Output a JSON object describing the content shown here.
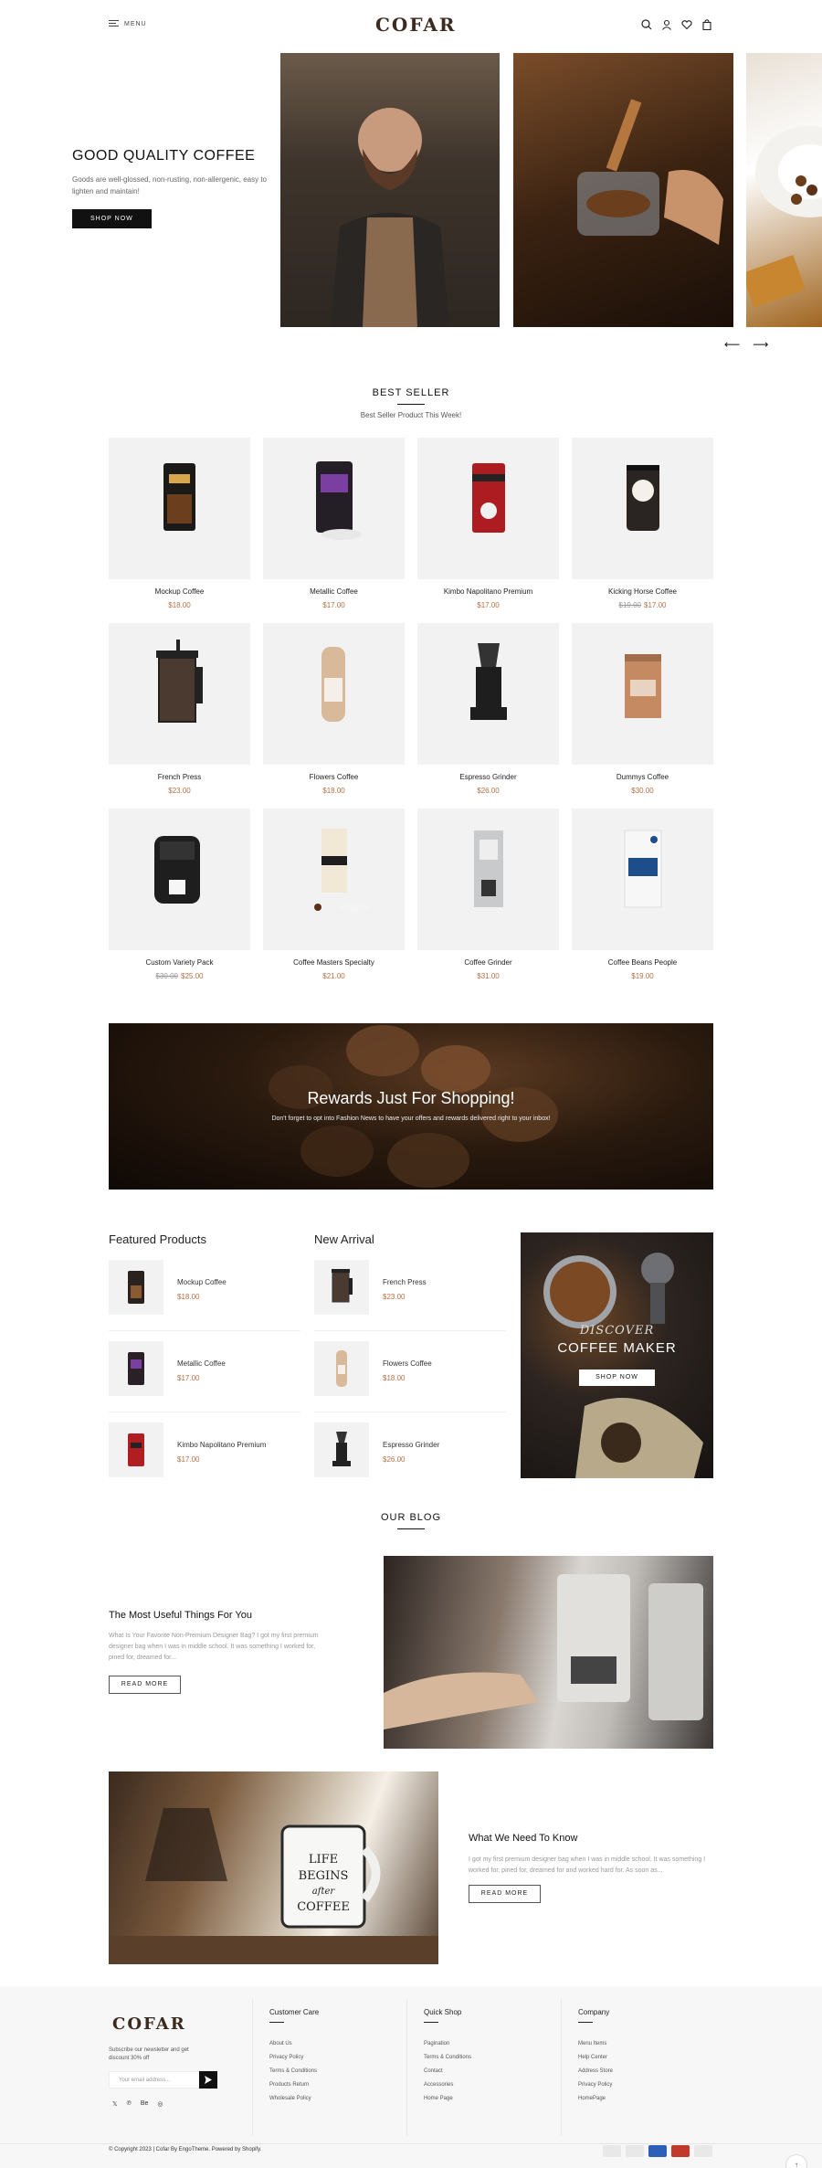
{
  "header": {
    "menu_label": "MENU",
    "logo": "COFAR"
  },
  "hero": {
    "title": "GOOD QUALITY COFFEE",
    "description": "Goods are well-glossed, non-rusting, non-allergenic, easy to lighten and maintain!",
    "button": "SHOP NOW"
  },
  "best_seller": {
    "title": "BEST SELLER",
    "subtitle": "Best Seller Product This Week!",
    "products": [
      {
        "name": "Mockup Coffee",
        "old_price": "",
        "price": "$18.00"
      },
      {
        "name": "Metallic Coffee",
        "old_price": "",
        "price": "$17.00"
      },
      {
        "name": "Kimbo Napolitano Premium",
        "old_price": "",
        "price": "$17.00"
      },
      {
        "name": "Kicking Horse Coffee",
        "old_price": "$19.00",
        "price": "$17.00"
      },
      {
        "name": "French Press",
        "old_price": "",
        "price": "$23.00"
      },
      {
        "name": "Flowers Coffee",
        "old_price": "",
        "price": "$18.00"
      },
      {
        "name": "Espresso Grinder",
        "old_price": "",
        "price": "$26.00"
      },
      {
        "name": "Dummys Coffee",
        "old_price": "",
        "price": "$30.00"
      },
      {
        "name": "Custom Variety Pack",
        "old_price": "$30.00",
        "price": "$25.00"
      },
      {
        "name": "Coffee Masters Specialty",
        "old_price": "",
        "price": "$21.00"
      },
      {
        "name": "Coffee Grinder",
        "old_price": "",
        "price": "$31.00"
      },
      {
        "name": "Coffee Beans People",
        "old_price": "",
        "price": "$19.00"
      }
    ]
  },
  "rewards": {
    "title": "Rewards Just For Shopping!",
    "subtitle": "Don't forget to opt into Fashion News to have your offers and rewards delivered right to your inbox!"
  },
  "featured": {
    "title": "Featured Products",
    "items": [
      {
        "name": "Mockup Coffee",
        "price": "$18.00"
      },
      {
        "name": "Metallic Coffee",
        "price": "$17.00"
      },
      {
        "name": "Kimbo Napolitano Premium",
        "price": "$17.00"
      }
    ]
  },
  "new_arrival": {
    "title": "New Arrival",
    "items": [
      {
        "name": "French Press",
        "price": "$23.00"
      },
      {
        "name": "Flowers Coffee",
        "price": "$18.00"
      },
      {
        "name": "Espresso Grinder",
        "price": "$26.00"
      }
    ]
  },
  "discover": {
    "subtitle": "DISCOVER",
    "title": "COFFEE MAKER",
    "button": "SHOP NOW"
  },
  "blog": {
    "title": "OUR BLOG",
    "posts": [
      {
        "title": "The Most Useful Things For You",
        "excerpt": "What Is Your Favorite Non-Premium Designer Bag? I got my first premium designer bag when I was in middle school. It was something I worked for, pined for, dreamed for...",
        "button": "READ MORE"
      },
      {
        "title": "What We Need To Know",
        "excerpt": "I got my first premium designer bag when I was in middle school. It was something I worked for, pined for, dreamed for and worked hard for. As soon as...",
        "button": "READ MORE"
      }
    ]
  },
  "footer": {
    "logo": "COFAR",
    "newsletter_text": "Subscribe our newsletter and get discount 30% off",
    "email_placeholder": "Your email address...",
    "social": [
      "𝕏",
      "℗",
      "Be",
      "◎"
    ],
    "columns": [
      {
        "title": "Customer Care",
        "links": [
          "About Us",
          "Privacy Policy",
          "Terms & Conditions",
          "Products Return",
          "Wholesale Policy"
        ]
      },
      {
        "title": "Quick Shop",
        "links": [
          "Pagination",
          "Terms & Conditions",
          "Contact",
          "Accessories",
          "Home Page"
        ]
      },
      {
        "title": "Company",
        "links": [
          "Menu Items",
          "Help Center",
          "Address Store",
          "Privacy Policy",
          "HomePage"
        ]
      }
    ],
    "copyright": "© Copyright 2023 | Cofar By EngoTheme. Powered by Shopify.",
    "back_to_top": "↑"
  },
  "colors": {
    "accent": "#b37045",
    "dark": "#111111",
    "brand": "#3b2a1f"
  }
}
